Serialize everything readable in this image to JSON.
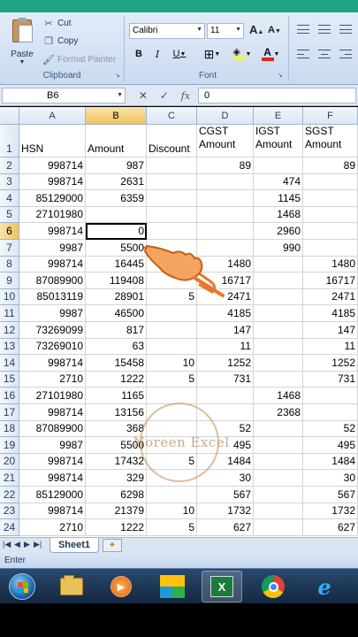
{
  "ribbon": {
    "clipboard": {
      "paste": "Paste",
      "cut": "Cut",
      "copy": "Copy",
      "format_painter": "Format Painter",
      "label": "Clipboard"
    },
    "font": {
      "name": "Calibri",
      "size": "11",
      "grow": "A",
      "shrink": "A",
      "bold": "B",
      "italic": "I",
      "underline": "U",
      "label": "Font"
    }
  },
  "formula_bar": {
    "name_box": "B6",
    "fx": "fx",
    "value": "0"
  },
  "columns": [
    "A",
    "B",
    "C",
    "D",
    "E",
    "F"
  ],
  "header_row": {
    "num": "1",
    "cells": [
      [
        "HSN"
      ],
      [
        "Amount"
      ],
      [
        "Discount"
      ],
      [
        "CGST",
        "Amount"
      ],
      [
        "IGST",
        "Amount"
      ],
      [
        "SGST",
        "Amount"
      ]
    ]
  },
  "rows": [
    {
      "num": "2",
      "cells": [
        "998714",
        "987",
        "",
        "89",
        "",
        "89"
      ]
    },
    {
      "num": "3",
      "cells": [
        "998714",
        "2631",
        "",
        "",
        "474",
        ""
      ]
    },
    {
      "num": "4",
      "cells": [
        "85129000",
        "6359",
        "",
        "",
        "1145",
        ""
      ]
    },
    {
      "num": "5",
      "cells": [
        "27101980",
        "",
        "",
        "",
        "1468",
        ""
      ]
    },
    {
      "num": "6",
      "cells": [
        "998714",
        "0",
        "",
        "",
        "2960",
        ""
      ]
    },
    {
      "num": "7",
      "cells": [
        "9987",
        "5500",
        "",
        "",
        "990",
        ""
      ]
    },
    {
      "num": "8",
      "cells": [
        "998714",
        "16445",
        "",
        "1480",
        "",
        "1480"
      ]
    },
    {
      "num": "9",
      "cells": [
        "87089900",
        "119408",
        "",
        "16717",
        "",
        "16717"
      ]
    },
    {
      "num": "10",
      "cells": [
        "85013119",
        "28901",
        "5",
        "2471",
        "",
        "2471"
      ]
    },
    {
      "num": "11",
      "cells": [
        "9987",
        "46500",
        "",
        "4185",
        "",
        "4185"
      ]
    },
    {
      "num": "12",
      "cells": [
        "73269099",
        "817",
        "",
        "147",
        "",
        "147"
      ]
    },
    {
      "num": "13",
      "cells": [
        "73269010",
        "63",
        "",
        "11",
        "",
        "11"
      ]
    },
    {
      "num": "14",
      "cells": [
        "998714",
        "15458",
        "10",
        "1252",
        "",
        "1252"
      ]
    },
    {
      "num": "15",
      "cells": [
        "2710",
        "1222",
        "5",
        "731",
        "",
        "731"
      ]
    },
    {
      "num": "16",
      "cells": [
        "27101980",
        "1165",
        "",
        "",
        "1468",
        ""
      ]
    },
    {
      "num": "17",
      "cells": [
        "998714",
        "13156",
        "",
        "",
        "2368",
        ""
      ]
    },
    {
      "num": "18",
      "cells": [
        "87089900",
        "368",
        "",
        "52",
        "",
        "52"
      ]
    },
    {
      "num": "19",
      "cells": [
        "9987",
        "5500",
        "",
        "495",
        "",
        "495"
      ]
    },
    {
      "num": "20",
      "cells": [
        "998714",
        "17432",
        "5",
        "1484",
        "",
        "1484"
      ]
    },
    {
      "num": "21",
      "cells": [
        "998714",
        "329",
        "",
        "30",
        "",
        "30"
      ]
    },
    {
      "num": "22",
      "cells": [
        "85129000",
        "6298",
        "",
        "567",
        "",
        "567"
      ]
    },
    {
      "num": "23",
      "cells": [
        "998714",
        "21379",
        "10",
        "1732",
        "",
        "1732"
      ]
    },
    {
      "num": "24",
      "cells": [
        "2710",
        "1222",
        "5",
        "627",
        "",
        "627"
      ]
    }
  ],
  "selected": {
    "row": "6",
    "col": "B"
  },
  "sheet_tab": "Sheet1",
  "status": "Enter",
  "watermark": "Noreen Excel",
  "colors": {
    "topbar": "#1da585",
    "excel_green": "#1e7a3a",
    "selection_header": "#f1c35c"
  }
}
